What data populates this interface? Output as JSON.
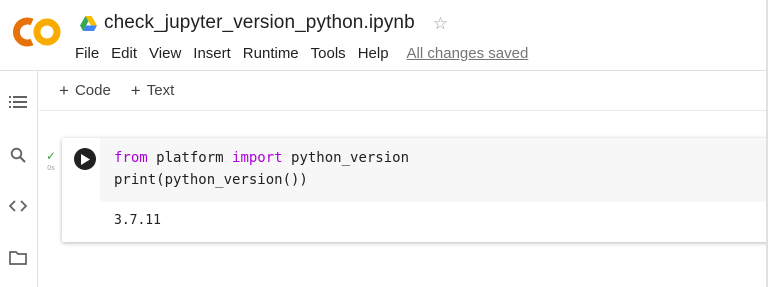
{
  "notebook": {
    "title": "check_jupyter_version_python.ipynb",
    "saved_status": "All changes saved"
  },
  "menu": [
    "File",
    "Edit",
    "View",
    "Insert",
    "Runtime",
    "Tools",
    "Help"
  ],
  "toolbar": {
    "code_label": "Code",
    "text_label": "Text"
  },
  "sidebar": {
    "icons": [
      "table-of-contents-icon",
      "search-icon",
      "code-snippets-icon",
      "files-folder-icon"
    ]
  },
  "cell": {
    "status": "✓",
    "exec_time": "0s",
    "code": {
      "line1": {
        "kw1": "from",
        "t1": " platform ",
        "kw2": "import",
        "t2": " python_version"
      },
      "line2": "print(python_version())"
    },
    "output": "3.7.11"
  },
  "colors": {
    "logo_orange": "#F9AB00",
    "logo_dark_orange": "#E8710A",
    "keyword": "#AF00DB",
    "check_green": "#43A047"
  }
}
